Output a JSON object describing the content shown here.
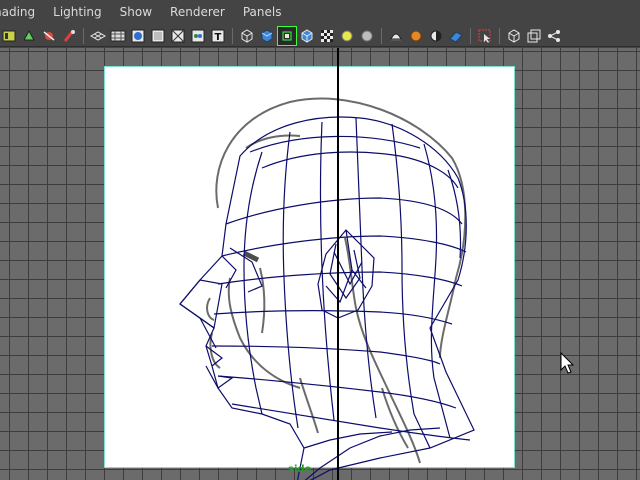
{
  "menubar": {
    "items": [
      "hading",
      "Lighting",
      "Show",
      "Renderer",
      "Panels"
    ]
  },
  "toolbar": {
    "icons": [
      "select-camera-icon",
      "camera-attributes-icon",
      "bookmark-icon",
      "image-plane-icon",
      "grid-icon",
      "film-gate-icon",
      "resolution-gate-icon",
      "gate-mask-icon",
      "field-chart-icon",
      "safe-action-icon",
      "safe-title-icon",
      "wireframe-icon",
      "smooth-shade-icon",
      "wireframe-on-shaded-icon",
      "xray-icon",
      "textured-icon",
      "use-all-lights-icon",
      "shadows-icon",
      "hq-render-icon",
      "ambient-occlusion-icon",
      "motion-blur-icon",
      "multisample-icon",
      "isolate-select-icon",
      "xray-joints-icon",
      "xray-active-icon",
      "show-joints-icon"
    ]
  },
  "viewport": {
    "camera_label": "side"
  },
  "colors": {
    "wireframe": "#0d0d6b",
    "sketch": "#333333",
    "selection_outline": "#3cff3c",
    "label": "#1fa01f"
  }
}
